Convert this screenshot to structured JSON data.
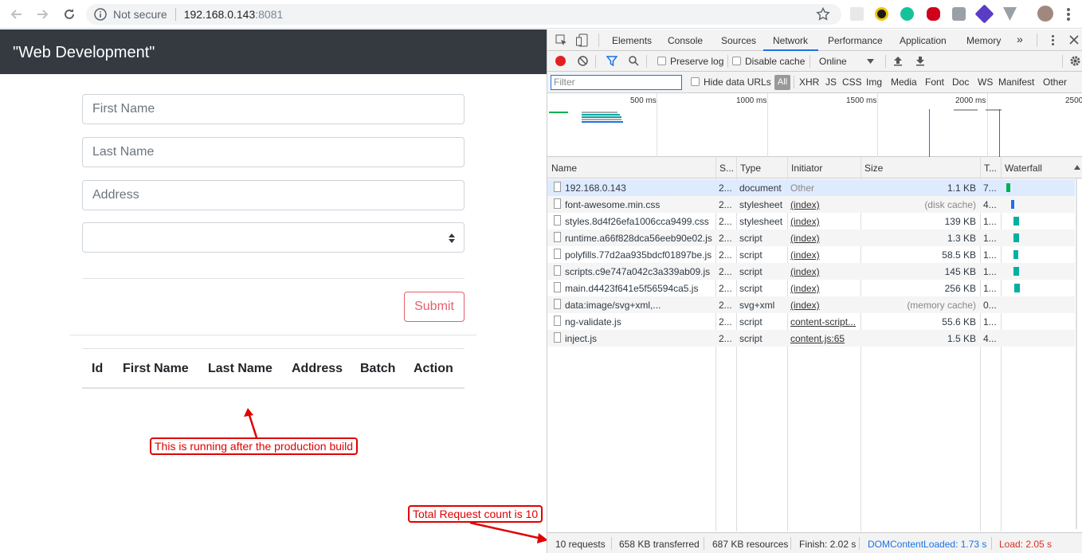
{
  "browser": {
    "security_text": "Not secure",
    "url_host": "192.168.0.143",
    "url_port": ":8081"
  },
  "app": {
    "title": "\"Web Development\"",
    "first_name_placeholder": "First Name",
    "last_name_placeholder": "Last Name",
    "address_placeholder": "Address",
    "submit_label": "Submit",
    "table_headers": [
      "Id",
      "First Name",
      "Last Name",
      "Address",
      "Batch",
      "Action"
    ]
  },
  "annotations": {
    "production_note": "This is running after the production build",
    "request_count_note": "Total Request count is 10",
    "color": "#e00000"
  },
  "devtools": {
    "tabs": [
      "Elements",
      "Console",
      "Sources",
      "Network",
      "Performance",
      "Application",
      "Memory",
      "»"
    ],
    "active_tab": "Network",
    "toolbar": {
      "preserve_log": "Preserve log",
      "disable_cache": "Disable cache",
      "throttle": "Online"
    },
    "filter": {
      "placeholder": "Filter",
      "hide_data_urls": "Hide data URLs",
      "all": "All",
      "types": [
        "XHR",
        "JS",
        "CSS",
        "Img",
        "Media",
        "Font",
        "Doc",
        "WS",
        "Manifest",
        "Other"
      ]
    },
    "overview_ticks": [
      "500 ms",
      "1000 ms",
      "1500 ms",
      "2000 ms",
      "2500"
    ],
    "columns": [
      "Name",
      "S...",
      "Type",
      "Initiator",
      "Size",
      "T...",
      "Waterfall"
    ],
    "requests": [
      {
        "name": "192.168.0.143",
        "status": "2...",
        "type": "document",
        "initiator": "Other",
        "size": "1.1 KB",
        "time": "7..."
      },
      {
        "name": "font-awesome.min.css",
        "status": "2...",
        "type": "stylesheet",
        "initiator": "(index)",
        "size": "(disk cache)",
        "time": "4..."
      },
      {
        "name": "styles.8d4f26efa1006cca9499.css",
        "status": "2...",
        "type": "stylesheet",
        "initiator": "(index)",
        "size": "139 KB",
        "time": "1..."
      },
      {
        "name": "runtime.a66f828dca56eeb90e02.js",
        "status": "2...",
        "type": "script",
        "initiator": "(index)",
        "size": "1.3 KB",
        "time": "1..."
      },
      {
        "name": "polyfills.77d2aa935bdcf01897be.js",
        "status": "2...",
        "type": "script",
        "initiator": "(index)",
        "size": "58.5 KB",
        "time": "1..."
      },
      {
        "name": "scripts.c9e747a042c3a339ab09.js",
        "status": "2...",
        "type": "script",
        "initiator": "(index)",
        "size": "145 KB",
        "time": "1..."
      },
      {
        "name": "main.d4423f641e5f56594ca5.js",
        "status": "2...",
        "type": "script",
        "initiator": "(index)",
        "size": "256 KB",
        "time": "1..."
      },
      {
        "name": "data:image/svg+xml,...",
        "status": "2...",
        "type": "svg+xml",
        "initiator": "(index)",
        "size": "(memory cache)",
        "time": "0..."
      },
      {
        "name": "ng-validate.js",
        "status": "2...",
        "type": "script",
        "initiator": "content-script...",
        "size": "55.6 KB",
        "time": "1..."
      },
      {
        "name": "inject.js",
        "status": "2...",
        "type": "script",
        "initiator": "content.js:65",
        "size": "1.5 KB",
        "time": "4..."
      }
    ],
    "status": {
      "requests": "10 requests",
      "transferred": "658 KB transferred",
      "resources": "687 KB resources",
      "finish": "Finish: 2.02 s",
      "dcl": "DOMContentLoaded: 1.73 s",
      "load": "Load: 2.05 s"
    },
    "colors": {
      "dcl": "#1a73e8",
      "load": "#d93025",
      "record": "#e41f1f"
    }
  }
}
